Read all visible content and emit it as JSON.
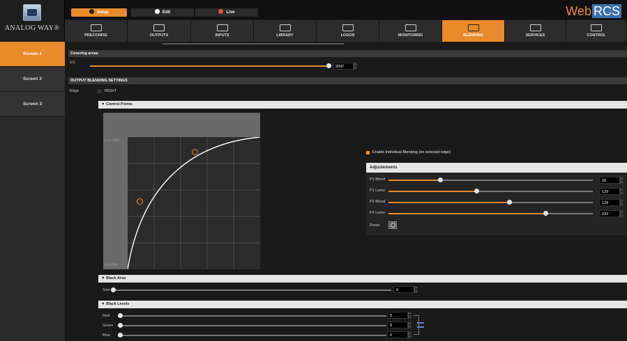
{
  "brand": {
    "logo_text": "ANALOG WAY®",
    "product_prefix": "Web",
    "product_badge": "RCS",
    "accent_color": "#e98a2b"
  },
  "modes": [
    {
      "label": "Setup",
      "icon": "gear-icon",
      "active": true
    },
    {
      "label": "Edit",
      "icon": "play-icon",
      "active": false
    },
    {
      "label": "Live",
      "icon": "live-dot-icon",
      "active": false
    }
  ],
  "tabs": [
    {
      "label": "PRECONFIG",
      "icon": "preconfig-icon"
    },
    {
      "label": "OUTPUTS",
      "icon": "outputs-icon"
    },
    {
      "label": "INPUTS",
      "icon": "inputs-icon"
    },
    {
      "label": "LIBRARY",
      "icon": "library-icon"
    },
    {
      "label": "LOGOS",
      "icon": "logos-icon"
    },
    {
      "label": "MONITORING",
      "icon": "monitoring-icon"
    },
    {
      "label": "BLENDING",
      "icon": "blending-icon",
      "active": true
    },
    {
      "label": "SERVICES",
      "icon": "services-icon"
    },
    {
      "label": "CONTROL",
      "icon": "control-icon"
    }
  ],
  "screens": [
    {
      "label": "Screen 1",
      "active": true
    },
    {
      "label": "Screen 2",
      "active": false
    },
    {
      "label": "Screen 3",
      "active": false
    }
  ],
  "covering": {
    "title": "Covering areas",
    "row_label": "1/1",
    "value": "2047",
    "fraction": 1.0
  },
  "output_blending": {
    "title": "OUTPUT BLENDING SETTINGS",
    "edge_label": "Edge",
    "edge_value": "RIGHT"
  },
  "control_points": {
    "title": "▼ Control Points",
    "max_label": "Lum Max",
    "min_label": "Lum Min",
    "enable_individual": "Enable Individual Blending (on selected edge)"
  },
  "adjustments": {
    "title": "Adjustements",
    "rows": [
      {
        "label": "P1 Blend",
        "value": "26",
        "fraction": 0.26
      },
      {
        "label": "P1 Lumo",
        "value": "129",
        "fraction": 0.45
      },
      {
        "label": "P2 Blend",
        "value": "128",
        "fraction": 0.61
      },
      {
        "label": "P2 Lumo",
        "value": "232",
        "fraction": 0.81
      }
    ],
    "reset_label": "Reset"
  },
  "black_area": {
    "title": "▼ Black Area",
    "size_label": "Size",
    "size_value": "0"
  },
  "black_levels": {
    "title": "▼ Black Levels",
    "rows": [
      {
        "label": "Red",
        "value": "0"
      },
      {
        "label": "Green",
        "value": "0"
      },
      {
        "label": "Blue",
        "value": "0"
      }
    ]
  }
}
